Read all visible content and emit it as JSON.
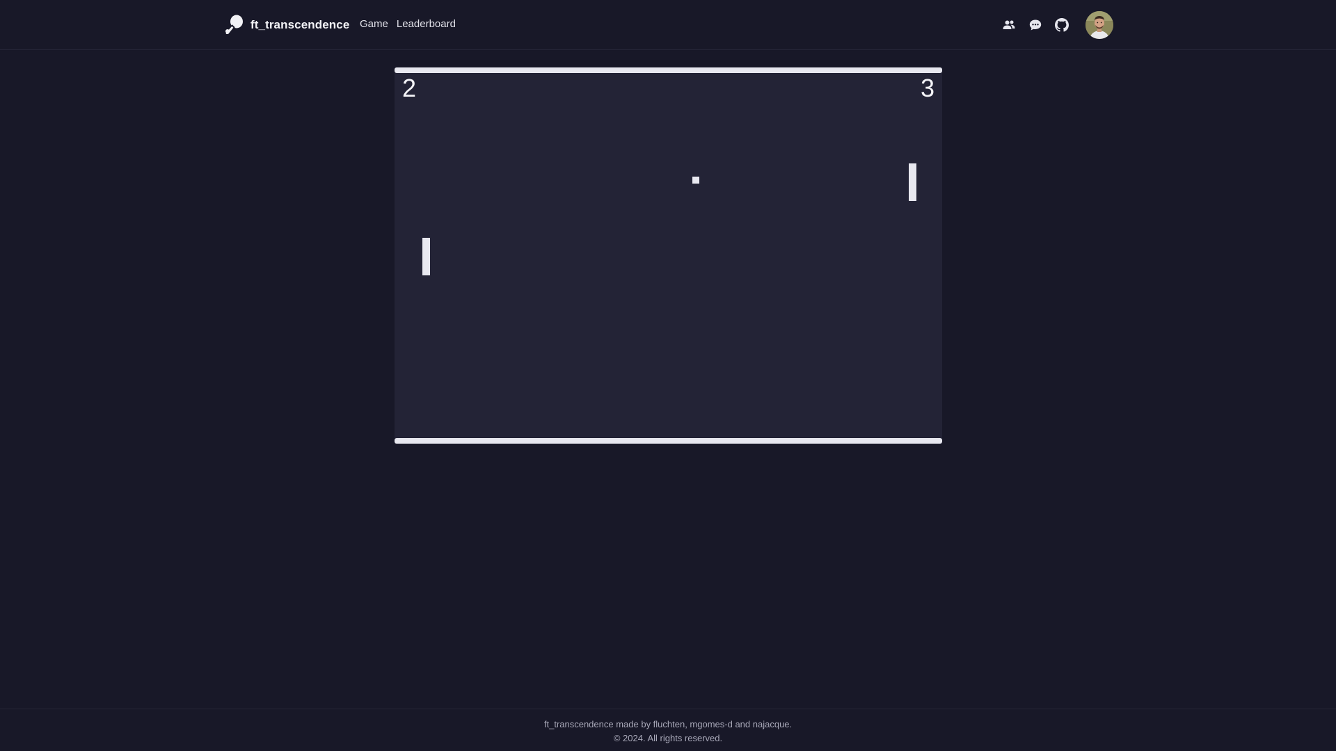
{
  "header": {
    "brand_name": "ft_transcendence",
    "nav": {
      "game": "Game",
      "leaderboard": "Leaderboard"
    },
    "icons": {
      "friends": "users-icon",
      "chat": "chat-bubble-icon",
      "github": "github-icon"
    }
  },
  "game": {
    "score_left": "2",
    "score_right": "3"
  },
  "footer": {
    "credits": "ft_transcendence made by fluchten, mgomes-d and najacque.",
    "copyright": "© 2024. All rights reserved."
  },
  "colors": {
    "background": "#181828",
    "board": "#232336",
    "foreground": "#e8e8f0"
  }
}
